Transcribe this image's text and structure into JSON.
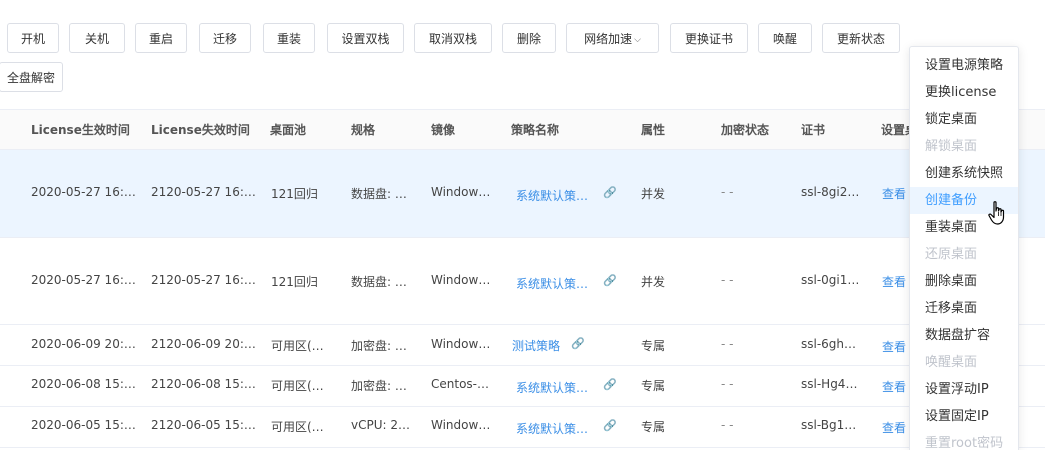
{
  "toolbar": {
    "buttons": [
      "开机",
      "关机",
      "重启",
      "迁移",
      "重装",
      "设置双栈",
      "取消双栈",
      "删除",
      "网络加速",
      "更换证书",
      "唤醒",
      "更新状态"
    ],
    "second_row_button": "全盘解密"
  },
  "table": {
    "headers": [
      "License生效时间",
      "License失效时间",
      "桌面池",
      "规格",
      "镜像",
      "策略名称",
      "属性",
      "加密状态",
      "证书",
      "设置桌"
    ],
    "rows": [
      {
        "lic_start": "2020-05-27 16:…",
        "lic_end": "2120-05-27 16:…",
        "pool": "121回归",
        "spec": "数据盘: …",
        "image": "Window…",
        "policy": "系统默认策…",
        "attr": "并发",
        "encrypt": "- -",
        "cert": "ssl-8gi2…",
        "action": "查看"
      },
      {
        "lic_start": "2020-05-27 16:…",
        "lic_end": "2120-05-27 16:…",
        "pool": "121回归",
        "spec": "数据盘: …",
        "image": "Window…",
        "policy": "系统默认策…",
        "attr": "并发",
        "encrypt": "- -",
        "cert": "ssl-0gi1…",
        "action": "查看"
      },
      {
        "lic_start": "2020-06-09 20:…",
        "lic_end": "2120-06-09 20:…",
        "pool": "可用区(…",
        "spec": "加密盘: …",
        "image": "Window…",
        "policy": "测试策略",
        "attr": "专属",
        "encrypt": "- -",
        "cert": "ssl-6gh…",
        "action": "查看"
      },
      {
        "lic_start": "2020-06-08 15:…",
        "lic_end": "2120-06-08 15:…",
        "pool": "可用区(…",
        "spec": "加密盘: …",
        "image": "Centos-…",
        "policy": "系统默认策…",
        "attr": "专属",
        "encrypt": "- -",
        "cert": "ssl-Hg4…",
        "action": "查看"
      },
      {
        "lic_start": "2020-06-05 15:…",
        "lic_end": "2120-06-05 15:…",
        "pool": "可用区(…",
        "spec": "vCPU: 2…",
        "image": "Window…",
        "policy": "系统默认策…",
        "attr": "专属",
        "encrypt": "- -",
        "cert": "ssl-Bg1…",
        "action": "查看"
      }
    ]
  },
  "menu": {
    "items": [
      {
        "label": "设置电源策略",
        "state": "normal"
      },
      {
        "label": "更换license",
        "state": "normal"
      },
      {
        "label": "锁定桌面",
        "state": "normal"
      },
      {
        "label": "解锁桌面",
        "state": "disabled"
      },
      {
        "label": "创建系统快照",
        "state": "normal"
      },
      {
        "label": "创建备份",
        "state": "active"
      },
      {
        "label": "重装桌面",
        "state": "normal"
      },
      {
        "label": "还原桌面",
        "state": "disabled"
      },
      {
        "label": "删除桌面",
        "state": "normal"
      },
      {
        "label": "迁移桌面",
        "state": "normal"
      },
      {
        "label": "数据盘扩容",
        "state": "normal"
      },
      {
        "label": "唤醒桌面",
        "state": "disabled"
      },
      {
        "label": "设置浮动IP",
        "state": "normal"
      },
      {
        "label": "设置固定IP",
        "state": "normal"
      },
      {
        "label": "重置root密码",
        "state": "disabled"
      }
    ]
  },
  "icons": {
    "dropdown": "chevron-down-icon",
    "policy_link": "link-icon",
    "pointer": "hand-pointer-icon"
  },
  "colors": {
    "link": "#3a8ee6",
    "active_row": "#ecf5ff",
    "active_item": "#409eff",
    "disabled": "#c0c4cc"
  }
}
